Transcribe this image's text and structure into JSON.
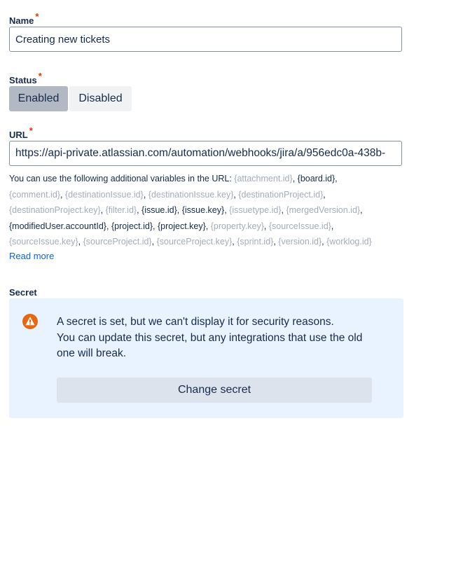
{
  "name_field": {
    "label": "Name",
    "required_marker": "*",
    "value": "Creating new tickets"
  },
  "status_field": {
    "label": "Status",
    "required_marker": "*",
    "options": [
      {
        "label": "Enabled",
        "selected": true
      },
      {
        "label": "Disabled",
        "selected": false
      }
    ]
  },
  "url_field": {
    "label": "URL",
    "required_marker": "*",
    "value": "https://api-private.atlassian.com/automation/webhooks/jira/a/956edc0a-438b-",
    "help_intro": "You can use the following additional variables in the URL: ",
    "variables": [
      {
        "text": "{attachment.id}",
        "style": "dim"
      },
      {
        "text": "{board.id}",
        "style": "dark"
      },
      {
        "text": "{comment.id}",
        "style": "dim"
      },
      {
        "text": "{destinationIssue.id}",
        "style": "dim"
      },
      {
        "text": "{destinationIssue.key}",
        "style": "dim"
      },
      {
        "text": "{destinationProject.id}",
        "style": "dim"
      },
      {
        "text": "{destinationProject.key}",
        "style": "dim"
      },
      {
        "text": "{filter.id}",
        "style": "dim"
      },
      {
        "text": "{issue.id}",
        "style": "dark"
      },
      {
        "text": "{issue.key}",
        "style": "dark"
      },
      {
        "text": "{issuetype.id}",
        "style": "dim"
      },
      {
        "text": "{mergedVersion.id}",
        "style": "dim"
      },
      {
        "text": "{modifiedUser.accountId}",
        "style": "dark"
      },
      {
        "text": "{project.id}",
        "style": "dark"
      },
      {
        "text": "{project.key}",
        "style": "dark"
      },
      {
        "text": "{property.key}",
        "style": "dim"
      },
      {
        "text": "{sourceIssue.id}",
        "style": "dim"
      },
      {
        "text": "{sourceIssue.key}",
        "style": "dim"
      },
      {
        "text": "{sourceProject.id}",
        "style": "dim"
      },
      {
        "text": "{sourceProject.key}",
        "style": "dim"
      },
      {
        "text": "{sprint.id}",
        "style": "dim"
      },
      {
        "text": "{version.id}",
        "style": "dim"
      },
      {
        "text": "{worklog.id}",
        "style": "dim"
      }
    ],
    "read_more_label": "Read more"
  },
  "secret_field": {
    "label": "Secret",
    "icon": "warning-icon",
    "message_line1": "A secret is set, but we can't display it for security reasons.",
    "message_line2": "You can update this secret, but any integrations that use the old one will break.",
    "change_button_label": "Change secret"
  },
  "colors": {
    "required": "#de350b",
    "link": "#0c66e4",
    "warning": "#e56910",
    "panel_bg": "#e9f2ff",
    "selected_toggle": "#b3b9c4"
  }
}
